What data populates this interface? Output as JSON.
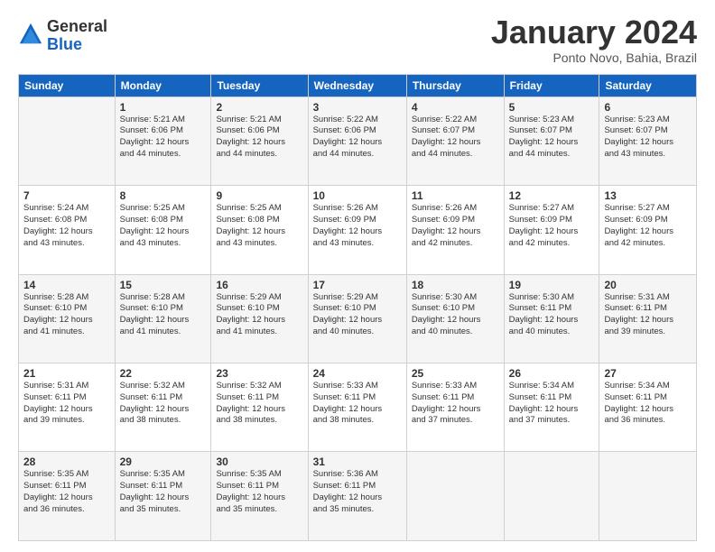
{
  "logo": {
    "general": "General",
    "blue": "Blue"
  },
  "header": {
    "title": "January 2024",
    "subtitle": "Ponto Novo, Bahia, Brazil"
  },
  "days_of_week": [
    "Sunday",
    "Monday",
    "Tuesday",
    "Wednesday",
    "Thursday",
    "Friday",
    "Saturday"
  ],
  "weeks": [
    [
      {
        "day": "",
        "text": ""
      },
      {
        "day": "1",
        "text": "Sunrise: 5:21 AM\nSunset: 6:06 PM\nDaylight: 12 hours\nand 44 minutes."
      },
      {
        "day": "2",
        "text": "Sunrise: 5:21 AM\nSunset: 6:06 PM\nDaylight: 12 hours\nand 44 minutes."
      },
      {
        "day": "3",
        "text": "Sunrise: 5:22 AM\nSunset: 6:06 PM\nDaylight: 12 hours\nand 44 minutes."
      },
      {
        "day": "4",
        "text": "Sunrise: 5:22 AM\nSunset: 6:07 PM\nDaylight: 12 hours\nand 44 minutes."
      },
      {
        "day": "5",
        "text": "Sunrise: 5:23 AM\nSunset: 6:07 PM\nDaylight: 12 hours\nand 44 minutes."
      },
      {
        "day": "6",
        "text": "Sunrise: 5:23 AM\nSunset: 6:07 PM\nDaylight: 12 hours\nand 43 minutes."
      }
    ],
    [
      {
        "day": "7",
        "text": "Sunrise: 5:24 AM\nSunset: 6:08 PM\nDaylight: 12 hours\nand 43 minutes."
      },
      {
        "day": "8",
        "text": "Sunrise: 5:25 AM\nSunset: 6:08 PM\nDaylight: 12 hours\nand 43 minutes."
      },
      {
        "day": "9",
        "text": "Sunrise: 5:25 AM\nSunset: 6:08 PM\nDaylight: 12 hours\nand 43 minutes."
      },
      {
        "day": "10",
        "text": "Sunrise: 5:26 AM\nSunset: 6:09 PM\nDaylight: 12 hours\nand 43 minutes."
      },
      {
        "day": "11",
        "text": "Sunrise: 5:26 AM\nSunset: 6:09 PM\nDaylight: 12 hours\nand 42 minutes."
      },
      {
        "day": "12",
        "text": "Sunrise: 5:27 AM\nSunset: 6:09 PM\nDaylight: 12 hours\nand 42 minutes."
      },
      {
        "day": "13",
        "text": "Sunrise: 5:27 AM\nSunset: 6:09 PM\nDaylight: 12 hours\nand 42 minutes."
      }
    ],
    [
      {
        "day": "14",
        "text": "Sunrise: 5:28 AM\nSunset: 6:10 PM\nDaylight: 12 hours\nand 41 minutes."
      },
      {
        "day": "15",
        "text": "Sunrise: 5:28 AM\nSunset: 6:10 PM\nDaylight: 12 hours\nand 41 minutes."
      },
      {
        "day": "16",
        "text": "Sunrise: 5:29 AM\nSunset: 6:10 PM\nDaylight: 12 hours\nand 41 minutes."
      },
      {
        "day": "17",
        "text": "Sunrise: 5:29 AM\nSunset: 6:10 PM\nDaylight: 12 hours\nand 40 minutes."
      },
      {
        "day": "18",
        "text": "Sunrise: 5:30 AM\nSunset: 6:10 PM\nDaylight: 12 hours\nand 40 minutes."
      },
      {
        "day": "19",
        "text": "Sunrise: 5:30 AM\nSunset: 6:11 PM\nDaylight: 12 hours\nand 40 minutes."
      },
      {
        "day": "20",
        "text": "Sunrise: 5:31 AM\nSunset: 6:11 PM\nDaylight: 12 hours\nand 39 minutes."
      }
    ],
    [
      {
        "day": "21",
        "text": "Sunrise: 5:31 AM\nSunset: 6:11 PM\nDaylight: 12 hours\nand 39 minutes."
      },
      {
        "day": "22",
        "text": "Sunrise: 5:32 AM\nSunset: 6:11 PM\nDaylight: 12 hours\nand 38 minutes."
      },
      {
        "day": "23",
        "text": "Sunrise: 5:32 AM\nSunset: 6:11 PM\nDaylight: 12 hours\nand 38 minutes."
      },
      {
        "day": "24",
        "text": "Sunrise: 5:33 AM\nSunset: 6:11 PM\nDaylight: 12 hours\nand 38 minutes."
      },
      {
        "day": "25",
        "text": "Sunrise: 5:33 AM\nSunset: 6:11 PM\nDaylight: 12 hours\nand 37 minutes."
      },
      {
        "day": "26",
        "text": "Sunrise: 5:34 AM\nSunset: 6:11 PM\nDaylight: 12 hours\nand 37 minutes."
      },
      {
        "day": "27",
        "text": "Sunrise: 5:34 AM\nSunset: 6:11 PM\nDaylight: 12 hours\nand 36 minutes."
      }
    ],
    [
      {
        "day": "28",
        "text": "Sunrise: 5:35 AM\nSunset: 6:11 PM\nDaylight: 12 hours\nand 36 minutes."
      },
      {
        "day": "29",
        "text": "Sunrise: 5:35 AM\nSunset: 6:11 PM\nDaylight: 12 hours\nand 35 minutes."
      },
      {
        "day": "30",
        "text": "Sunrise: 5:35 AM\nSunset: 6:11 PM\nDaylight: 12 hours\nand 35 minutes."
      },
      {
        "day": "31",
        "text": "Sunrise: 5:36 AM\nSunset: 6:11 PM\nDaylight: 12 hours\nand 35 minutes."
      },
      {
        "day": "",
        "text": ""
      },
      {
        "day": "",
        "text": ""
      },
      {
        "day": "",
        "text": ""
      }
    ]
  ]
}
